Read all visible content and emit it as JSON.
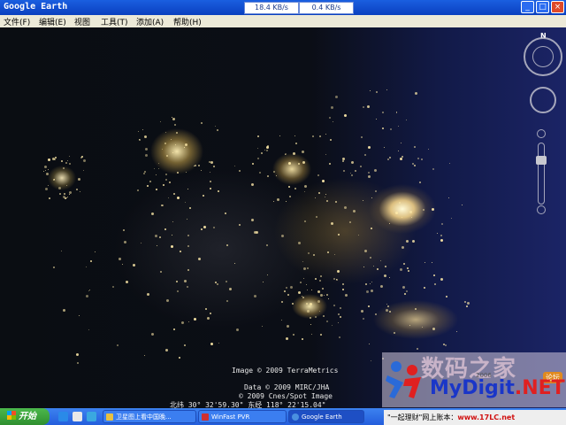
{
  "window": {
    "title": "Google Earth",
    "download_speed": "18.4 KB/s",
    "upload_speed": "0.4 KB/s",
    "minimize": "_",
    "maximize": "□",
    "close": "×"
  },
  "menu": [
    {
      "label": "文件(F)"
    },
    {
      "label": "编辑(E)"
    },
    {
      "label": "视图"
    },
    {
      "label": "工具(T)"
    },
    {
      "label": "添加(A)"
    },
    {
      "label": "帮助(H)"
    }
  ],
  "map": {
    "credit_imagery": "Image © 2009 TerraMetrics",
    "credit_data": "Data © 2009 MIRC/JHA",
    "credit_spot": "© 2009 Cnes/Spot Image",
    "coordinates": "北纬 30° 32'59.30\"  东经 118° 22'15.04\"",
    "nav_north": "N"
  },
  "watermark": {
    "title": "数码之家",
    "url_main": "MyDigit",
    "url_tld": ".NET",
    "tag": "论坛",
    "small": "2006"
  },
  "taskbar": {
    "start_label": "开始",
    "tasks": [
      {
        "label": "卫星图上看中国晚..."
      },
      {
        "label": "WinFast PVR"
      },
      {
        "label": "Google Earth"
      }
    ],
    "tray_text": "\"一起理财\"网上账本：",
    "tray_url": "www.17LC.net"
  },
  "colors": {
    "titlebar": "#1a5fe0",
    "menubar": "#ece9d8",
    "taskbar": "#245edc",
    "start": "#2f8f2f"
  }
}
